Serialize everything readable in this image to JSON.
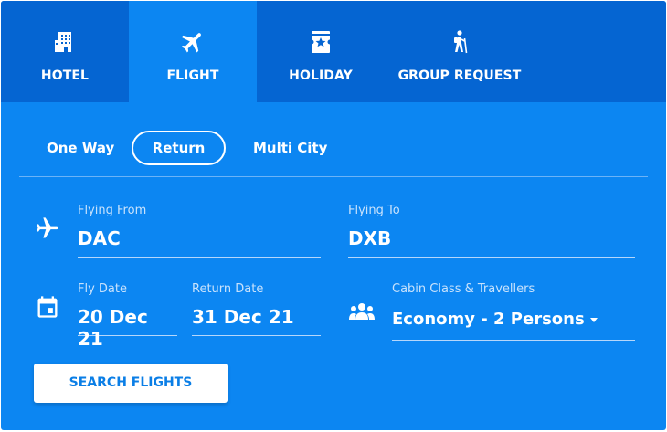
{
  "tabs": [
    {
      "label": "HOTEL",
      "icon": "hotel-icon"
    },
    {
      "label": "FLIGHT",
      "icon": "airplane-icon",
      "active": true
    },
    {
      "label": "HOLIDAY",
      "icon": "holiday-ticket-icon"
    },
    {
      "label": "GROUP REQUEST",
      "icon": "hiker-icon"
    }
  ],
  "trip_types": {
    "one_way": "One Way",
    "return": "Return",
    "multi_city": "Multi City",
    "selected": "Return"
  },
  "form": {
    "from_label": "Flying From",
    "from_value": "DAC",
    "to_label": "Flying To",
    "to_value": "DXB",
    "fly_date_label": "Fly Date",
    "fly_date_value": "20 Dec 21",
    "return_date_label": "Return Date",
    "return_date_value": "31 Dec 21",
    "cabin_label": "Cabin Class & Travellers",
    "cabin_value": "Economy - 2 Persons"
  },
  "search_button": "SEARCH FLIGHTS",
  "colors": {
    "panel": "#0c86f2",
    "tab_bar": "#0565d2",
    "text": "#ffffff",
    "button_text": "#0a7ee6"
  }
}
